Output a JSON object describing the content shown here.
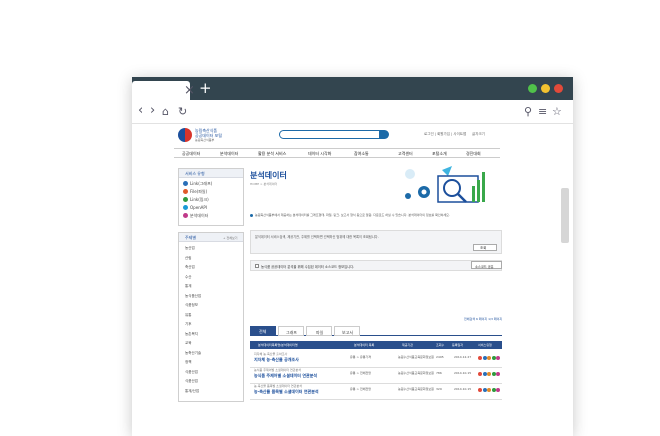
{
  "header": {
    "logo_line1": "농림축산식품",
    "logo_line2": "공공데이터 포털",
    "logo_line3": "농림축산식품부",
    "util_links": "로그인 | 회원가입 | 사이트맵",
    "font_size": "글자크기"
  },
  "nav": [
    "공공데이터",
    "분석데이터",
    "활용 분석 서비스",
    "데이터 시각화",
    "참여소통",
    "고객센터",
    "포털소개",
    "경진대회"
  ],
  "sidebar": {
    "service_title": "서비스 유형",
    "services": [
      "Link(그래프)",
      "File(파일)",
      "Link(링크)",
      "OpenAPI",
      "분석데이터"
    ],
    "subject_title": "주제별",
    "subject_more": "+ 전체보기",
    "subjects": [
      "농산업",
      "산림",
      "축산업",
      "수산",
      "통계",
      "농식품산업",
      "식품정보",
      "유통",
      "기후",
      "농촌복지",
      "교육",
      "농축산기술",
      "정책",
      "식품산업",
      "식품산업",
      "통계/산업"
    ]
  },
  "main": {
    "title": "분석데이터",
    "breadcrumb": "HOME > 분석데이터",
    "intro": "농림축산식품부에서 제공하는 분석데이터를 그래프형태, 파일, 링크, 보고서 형식 등으로 열람, 다운로드 하실 수 있습니다. 분석데이터의 정보를 확인하세요.",
    "search_label": "분석데이터 서비스검색, 제공기관, 주제를 선택하면 선택하신 범위에 대한 목록이 조회됩니다.",
    "search_button": "조회",
    "checkbox_label": "농식품 공공데이터 분석을 위해 수집된 데이터 소스코드 정보입니다.",
    "source_button": "소스코드 공유",
    "tabs": [
      "전체",
      "그래프",
      "파일",
      "보고서"
    ],
    "count_text": "전체검색 6 페이지 1/3 페이지",
    "columns": [
      "분석데이터목록명/분석데이터명",
      "분석데이터 목록",
      "제공기관",
      "조회수",
      "등록일자",
      "서비스유형"
    ],
    "rows": [
      {
        "sub": "지자체 농·축산물 출하조사",
        "name": "지자체 농·축산물 공개조사",
        "type": "유통 > 유통가격",
        "org": "농림수산식품교육문화정보원",
        "views": "2495",
        "date": "2014.12.27"
      },
      {
        "sub": "농식품 주제어별 소셜데이터 연관분석",
        "name": "농식품 주제어별 소셜데이터 연관분석",
        "type": "유통 > 전체전망",
        "org": "농림수산식품교육문화정보원",
        "views": "786",
        "date": "2014.10.15"
      },
      {
        "sub": "농·축산물 품목별 소셜데이터 연관분석",
        "name": "농·축산물 품목별 소셜데이터 연관분석",
        "type": "유통 > 전체전망",
        "org": "농림수산식품교육문화정보원",
        "views": "329",
        "date": "2014.10.15"
      }
    ]
  },
  "colors": {
    "titlebar": "#33454f",
    "nav_accent": "#1c6aa8",
    "table_head": "#2a4f8c",
    "dot_green": "#50c24a",
    "dot_yellow": "#f2c230",
    "dot_red": "#e24a3a"
  }
}
